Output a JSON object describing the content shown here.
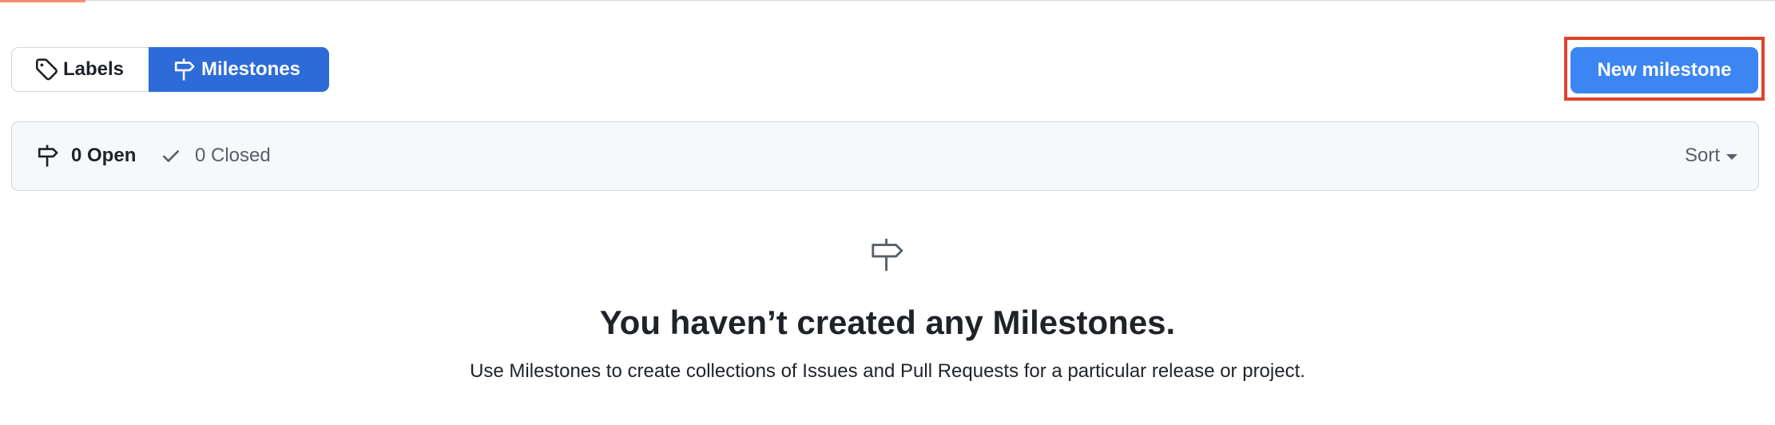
{
  "subnav": {
    "labels_label": "Labels",
    "milestones_label": "Milestones",
    "labels_icon": "tag-icon",
    "milestones_icon": "milestone-icon",
    "active": "Milestones"
  },
  "actions": {
    "new_milestone_label": "New milestone"
  },
  "filters": {
    "open_label": "0 Open",
    "closed_label": "0 Closed",
    "sort_label": "Sort"
  },
  "blankslate": {
    "title": "You haven’t created any Milestones.",
    "description": "Use Milestones to create collections of Issues and Pull Requests for a particular release or project."
  },
  "colors": {
    "primary_button": "#3b86f3",
    "active_tab": "#2d6bd9",
    "highlight": "#e0432b",
    "header_bg": "#f6f8fa"
  }
}
